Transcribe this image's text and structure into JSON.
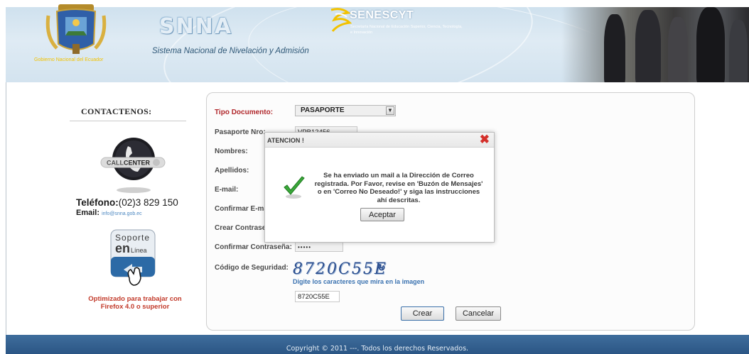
{
  "header": {
    "gob_label": "Gobierno Nacional del Ecuador",
    "snna_logo": "SNNA",
    "snna_subtitle": "Sistema Nacional de Nivelación y Admisión",
    "senescyt_title": "SENESCYT",
    "senescyt_desc": "Secretaría Nacional de Educación Superior, Ciencia, Tecnología, e Innovación"
  },
  "sidebar": {
    "contact_title": "CONTACTENOS:",
    "callcenter_label": "CALL CENTER",
    "phone_label": "Teléfono:",
    "phone_value": "(02)3 829 150",
    "email_label": "Email:",
    "email_value": "info@snna.gob.ec",
    "soporte_line1": "Soporte",
    "soporte_line2": "en",
    "soporte_line3": "Línea",
    "optimized_line1": "Optimizado para trabajar con",
    "optimized_line2": "Firefox 4.0 o superior"
  },
  "form": {
    "tipo_documento_label": "Tipo Documento:",
    "tipo_documento_value": "PASAPORTE",
    "pasaporte_label": "Pasaporte Nro:",
    "pasaporte_value": "VPB12456",
    "nombres_label": "Nombres:",
    "apellidos_label": "Apellidos:",
    "email_label": "E-mail:",
    "confirmar_email_label": "Confirmar E-mail:",
    "crear_contrasena_label": "Crear Contraseña:",
    "confirmar_contrasena_label": "Confirmar Contraseña:",
    "confirmar_contrasena_value": "•••••",
    "codigo_label": "Código de Seguridad:",
    "captcha_image_text": "8720C55E",
    "captcha_hint": "Digite los caracteres que mira en la imagen",
    "captcha_input_value": "8720C55E",
    "crear_button": "Crear",
    "cancelar_button": "Cancelar"
  },
  "modal": {
    "title": "ATENCION !",
    "close_symbol": "✖",
    "message": "Se ha enviado un mail a la Dirección de Correo registrada. Por Favor, revise en 'Buzón de Mensajes' o en 'Correo No Deseado!' y siga las instrucciones ahí descritas.",
    "accept_button": "Aceptar"
  },
  "footer": {
    "copyright": "Copyright © 2011 ---. Todos los derechos Reservados."
  },
  "colors": {
    "header_bg": "#d3e3ef",
    "footer_bg": "#2b5685",
    "label_red": "#b0272b",
    "close_red": "#d4302b",
    "link_blue": "#3a72b0"
  }
}
